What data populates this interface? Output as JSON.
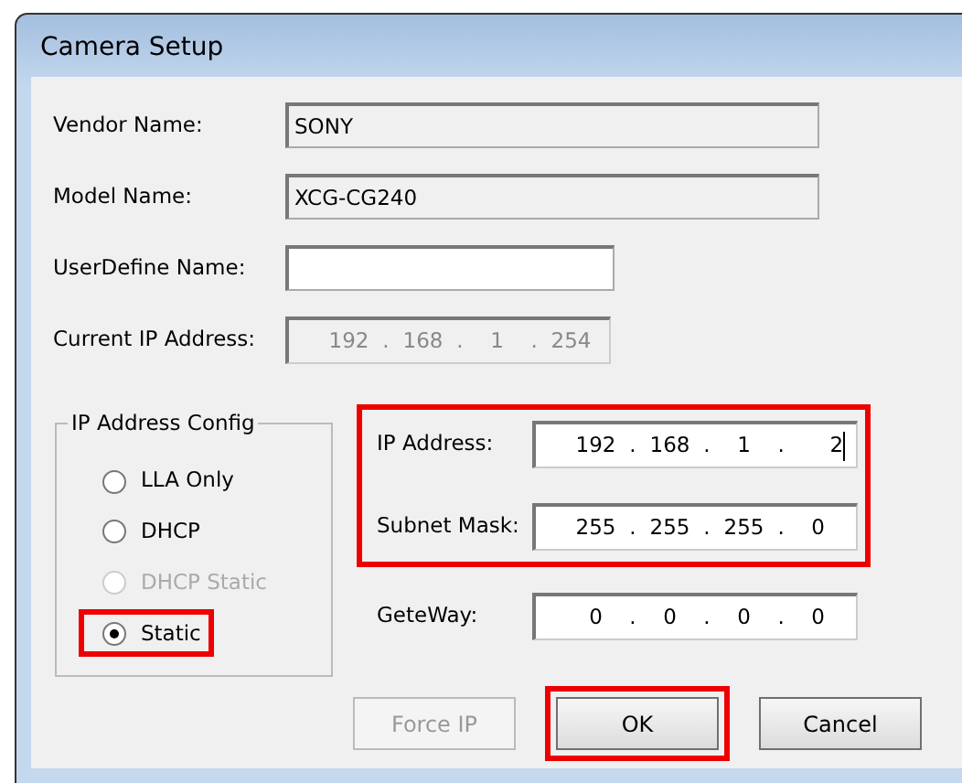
{
  "window": {
    "title": "Camera Setup"
  },
  "fields": [
    {
      "label": "Vendor Name:",
      "value": "SONY",
      "kind": "readonly"
    },
    {
      "label": "Model Name:",
      "value": "XCG-CG240",
      "kind": "readonly"
    },
    {
      "label": "UserDefine Name:",
      "kind": "editable"
    },
    {
      "label": "Current IP Address:",
      "kind": "ip",
      "disabled": true,
      "separator": ".",
      "octets": [
        "192",
        "168",
        "1",
        "254"
      ]
    }
  ],
  "ip_config": {
    "title": "IP Address Config",
    "options": [
      {
        "label": "LLA Only",
        "selected": false,
        "disabled": false,
        "highlighted": false
      },
      {
        "label": "DHCP",
        "selected": false,
        "disabled": false,
        "highlighted": false
      },
      {
        "label": "DHCP Static",
        "selected": false,
        "disabled": true,
        "highlighted": false
      },
      {
        "label": "Static",
        "selected": true,
        "disabled": false,
        "highlighted": true
      }
    ]
  },
  "address_group": {
    "highlighted": true,
    "fields": [
      {
        "label": "IP Address:",
        "separator": ".",
        "octets": [
          "192",
          "168",
          "1",
          "2"
        ],
        "focused": true
      },
      {
        "label": "Subnet Mask:",
        "separator": ".",
        "octets": [
          "255",
          "255",
          "255",
          "0"
        ]
      }
    ]
  },
  "gateway": {
    "label": "GeteWay:",
    "separator": ".",
    "octets": [
      "0",
      "0",
      "0",
      "0"
    ]
  },
  "buttons": [
    {
      "label": "Force IP",
      "disabled": true,
      "highlighted": false
    },
    {
      "label": "OK",
      "disabled": false,
      "highlighted": true
    },
    {
      "label": "Cancel",
      "disabled": false,
      "highlighted": false
    }
  ]
}
